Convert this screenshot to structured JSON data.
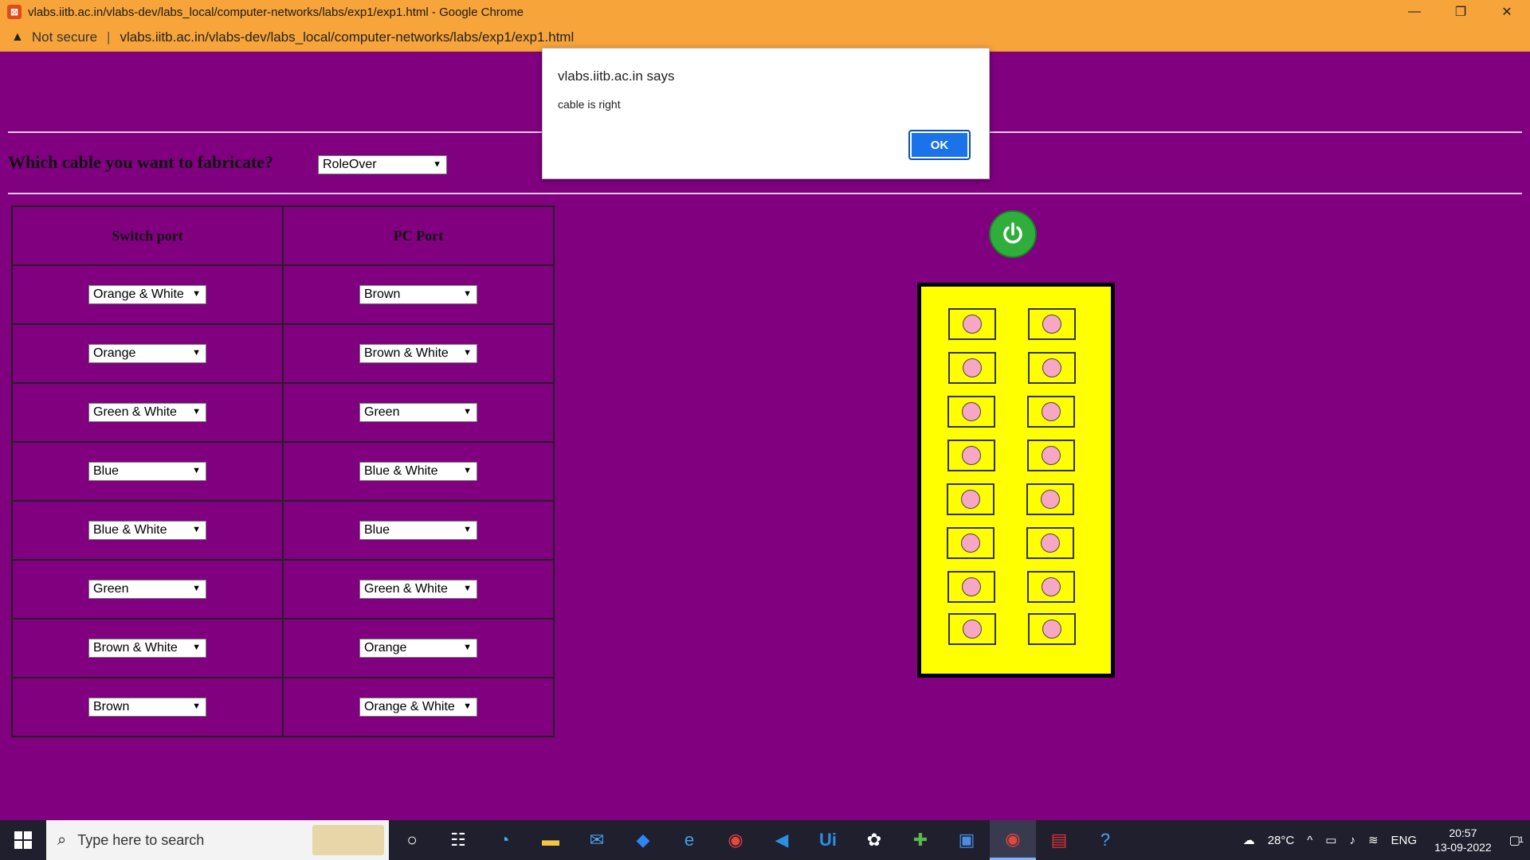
{
  "window": {
    "title": "vlabs.iitb.ac.in/vlabs-dev/labs_local/computer-networks/labs/exp1/exp1.html - Google Chrome",
    "minimize": "—",
    "restore": "❐",
    "close": "✕"
  },
  "address": {
    "security": "Not secure",
    "separator": "|",
    "url": "vlabs.iitb.ac.in/vlabs-dev/labs_local/computer-networks/labs/exp1/exp1.html"
  },
  "page": {
    "question": "Which cable you want to fabricate?",
    "cable_type": "RoleOver",
    "headers": {
      "switch": "Switch port",
      "pc": "PC Port"
    },
    "rows": [
      {
        "switch": "Orange & White",
        "pc": "Brown"
      },
      {
        "switch": "Orange",
        "pc": "Brown & White"
      },
      {
        "switch": "Green & White",
        "pc": "Green"
      },
      {
        "switch": "Blue",
        "pc": "Blue & White"
      },
      {
        "switch": "Blue & White",
        "pc": "Blue"
      },
      {
        "switch": "Green",
        "pc": "Green & White"
      },
      {
        "switch": "Brown & White",
        "pc": "Orange"
      },
      {
        "switch": "Brown",
        "pc": "Orange & White"
      }
    ]
  },
  "dialog": {
    "title": "vlabs.iitb.ac.in says",
    "message": "cable is right",
    "ok": "OK"
  },
  "taskbar": {
    "search_placeholder": "Type here to search",
    "weather": "28°C",
    "language": "ENG",
    "time": "20:57",
    "date": "13-09-2022",
    "notification_count": "1"
  },
  "colors": {
    "page_bg": "#800080",
    "chrome_bar": "#f7a43a",
    "board": "#ffff00",
    "power": "#2fae3b",
    "ok_button": "#1a73e8"
  }
}
